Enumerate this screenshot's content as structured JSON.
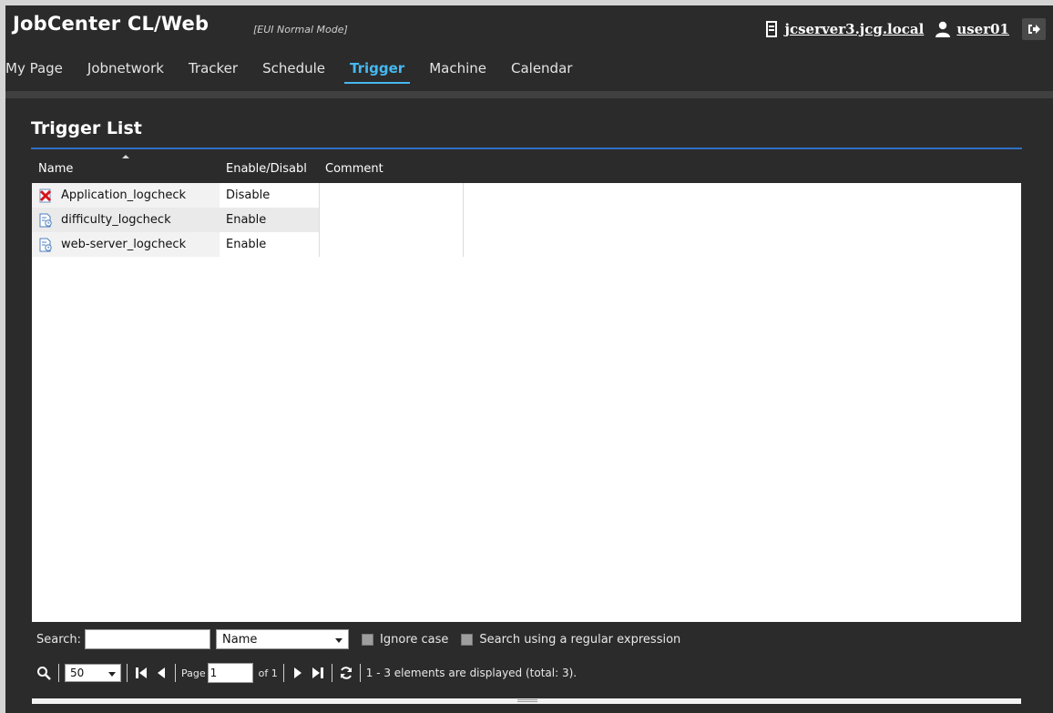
{
  "header": {
    "app_title": "JobCenter CL/Web",
    "mode": "[EUI Normal Mode]",
    "server": "jcserver3.jcg.local",
    "user": "user01",
    "icons": {
      "server": "server-icon",
      "user": "user-icon",
      "logout": "logout-icon"
    }
  },
  "nav": {
    "tabs": [
      {
        "label": "My Page"
      },
      {
        "label": "Jobnetwork"
      },
      {
        "label": "Tracker"
      },
      {
        "label": "Schedule"
      },
      {
        "label": "Trigger",
        "active": true
      },
      {
        "label": "Machine"
      },
      {
        "label": "Calendar"
      }
    ]
  },
  "panel": {
    "title": "Trigger List",
    "columns": {
      "name": "Name",
      "status": "Enable/Disabl",
      "comment": "Comment"
    },
    "rows": [
      {
        "name": "Application_logcheck",
        "status": "Disable",
        "comment": "",
        "icon": "disabled-trigger-icon"
      },
      {
        "name": "difficulty_logcheck",
        "status": "Enable",
        "comment": "",
        "icon": "trigger-icon"
      },
      {
        "name": "web-server_logcheck",
        "status": "Enable",
        "comment": "",
        "icon": "trigger-icon"
      }
    ]
  },
  "search": {
    "label": "Search:",
    "value": "",
    "field_select": "Name",
    "ignore_case": "Ignore case",
    "regex": "Search using a regular expression"
  },
  "pager": {
    "page_size": "50",
    "page_label": "Page",
    "page_value": "1",
    "of_label": "of 1",
    "status": "1 - 3 elements are displayed (total: 3)."
  },
  "colors": {
    "accent": "#46b8f0",
    "panel_line": "#2f6fc6",
    "background": "#2b2b2b"
  }
}
